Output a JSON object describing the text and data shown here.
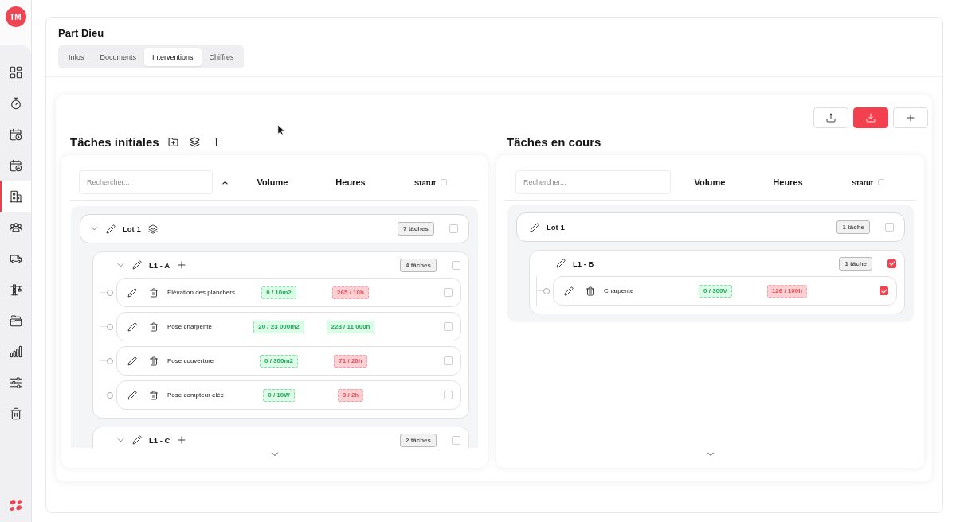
{
  "sidebar": {
    "avatar": "TM",
    "nav": [
      {
        "selected": false
      },
      {
        "selected": false
      },
      {
        "selected": false
      },
      {
        "selected": false
      },
      {
        "selected": true
      },
      {
        "selected": false
      },
      {
        "selected": false
      },
      {
        "selected": false
      },
      {
        "selected": false
      },
      {
        "selected": false
      },
      {
        "selected": false
      },
      {
        "selected": false
      }
    ]
  },
  "project": {
    "title": "Part Dieu",
    "tabs": [
      {
        "label": "Infos",
        "selected": false
      },
      {
        "label": "Documents",
        "selected": false
      },
      {
        "label": "Interventions",
        "selected": true
      },
      {
        "label": "Chiffres",
        "selected": false
      }
    ]
  },
  "panels": [
    {
      "title": "Tâches initiales",
      "search": {
        "placeholder": "Rechercher..."
      },
      "columns": [
        "Volume",
        "Heures",
        "Statut"
      ],
      "status_checked": false,
      "lots": [
        {
          "name": "Lot 1",
          "count": "7 tâches",
          "expanded": true,
          "checked": false,
          "children": [
            {
              "name": "L1 - A",
              "count": "4 tâches",
              "expanded": true,
              "checked": false,
              "children": [
                {
                  "name": "Élévation des planchers",
                  "volume": {
                    "text": "0 / 10m2",
                    "over": false
                  },
                  "hours": {
                    "text": "265 / 10h",
                    "over": true
                  },
                  "checked": false
                },
                {
                  "name": "Pose charpente",
                  "volume": {
                    "text": "20 / 23 000m2",
                    "over": false
                  },
                  "hours": {
                    "text": "228 / 11 000h",
                    "over": false
                  },
                  "checked": false
                },
                {
                  "name": "Pose couverture",
                  "volume": {
                    "text": "0 / 300m2",
                    "over": false
                  },
                  "hours": {
                    "text": "71 / 20h",
                    "over": true
                  },
                  "checked": false
                },
                {
                  "name": "Pose compteur éléc",
                  "volume": {
                    "text": "0 / 10W",
                    "over": false
                  },
                  "hours": {
                    "text": "8 / 2h",
                    "over": true
                  },
                  "checked": false
                }
              ]
            },
            {
              "name": "L1 - C",
              "count": "2 tâches",
              "expanded": true,
              "checked": false
            }
          ]
        }
      ]
    },
    {
      "title": "Tâches en cours",
      "search": {
        "placeholder": "Rechercher..."
      },
      "columns": [
        "Volume",
        "Heures",
        "Statut"
      ],
      "status_checked": false,
      "lots": [
        {
          "name": "Lot 1",
          "count": "1 tâche",
          "checked": false,
          "children": [
            {
              "name": "L1 - B",
              "count": "1 tâche",
              "checked": true,
              "children": [
                {
                  "name": "Charpente",
                  "volume": {
                    "text": "0 / 300V",
                    "over": false
                  },
                  "hours": {
                    "text": "126 / 100h",
                    "over": true
                  },
                  "checked": true
                }
              ]
            }
          ]
        }
      ]
    }
  ]
}
